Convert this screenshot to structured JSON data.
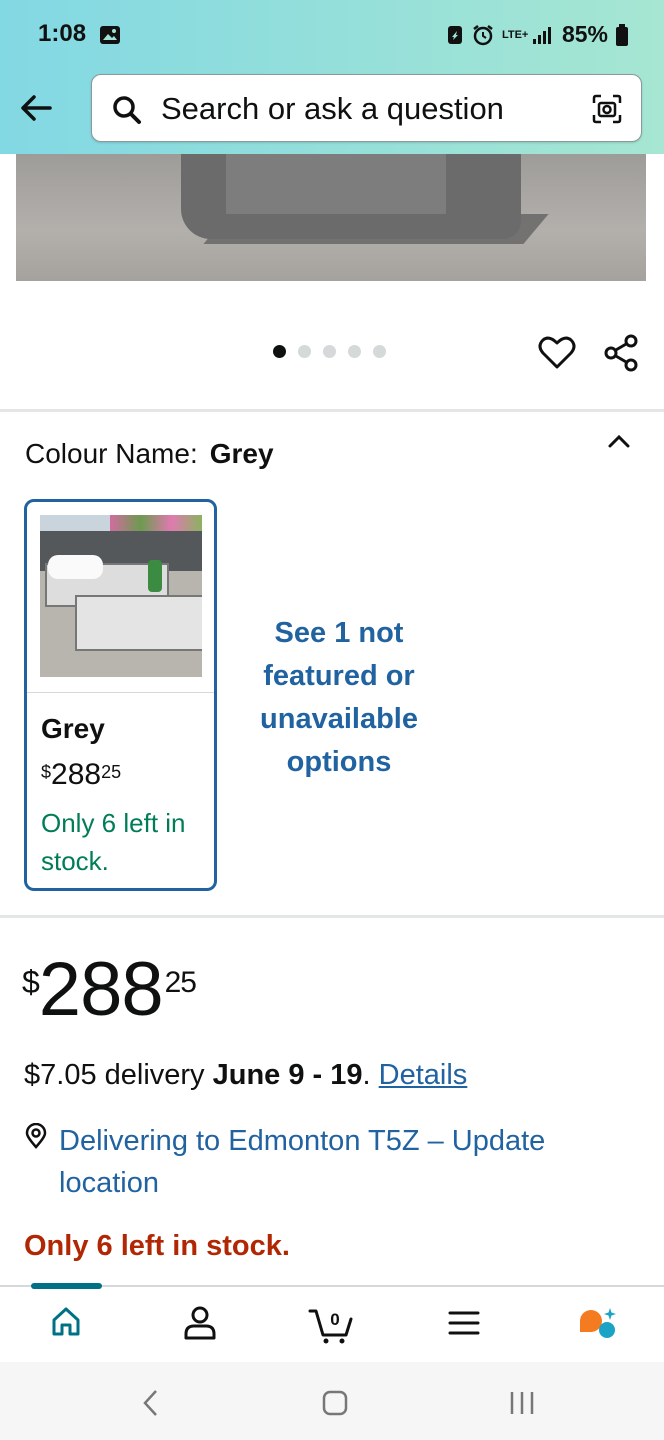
{
  "status_bar": {
    "time": "1:08",
    "network": "LTE+",
    "battery": "85%"
  },
  "search": {
    "placeholder": "Search or ask a question"
  },
  "image_carousel": {
    "total": 5,
    "active_index": 0
  },
  "variation": {
    "label": "Colour Name:",
    "selected": "Grey",
    "option": {
      "name": "Grey",
      "price_currency": "$",
      "price_whole": "288",
      "price_fraction": "25",
      "stock": "Only 6 left in stock."
    },
    "see_more": "See 1 not featured or unavailable options"
  },
  "buybox": {
    "price_currency": "$",
    "price_whole": "288",
    "price_fraction": "25",
    "delivery_prefix": "$7.05 delivery",
    "delivery_dates": "June 9 - 19",
    "delivery_dot": ".",
    "details_link": "Details",
    "location": "Delivering to Edmonton T5Z – Update location",
    "stock": "Only 6 left in stock."
  },
  "bottom_nav": {
    "items": [
      "home-icon",
      "account-icon",
      "cart-icon",
      "menu-icon",
      "rufus-icon"
    ],
    "cart_count": "0",
    "accent_color": "#007185"
  }
}
